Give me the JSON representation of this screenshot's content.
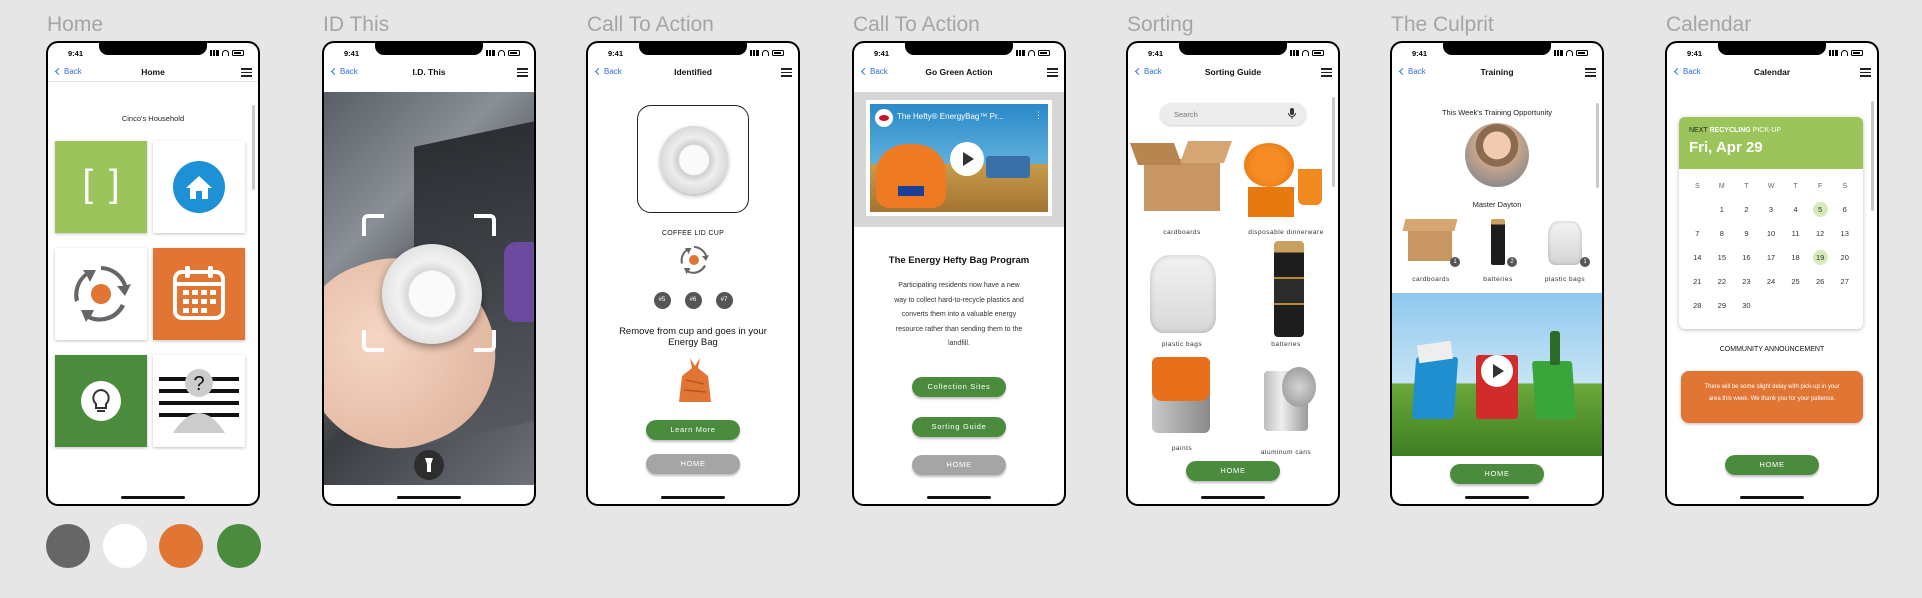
{
  "status_time": "9:41",
  "back_label": "Back",
  "colors": {
    "gray": "#666666",
    "white": "#ffffff",
    "orange": "#e07534",
    "green": "#4a8b3e",
    "lime": "#9bc45a"
  },
  "screens": [
    {
      "frame_title": "Home",
      "nav_title": "Home",
      "household": "Cinco's Household"
    },
    {
      "frame_title": "ID This",
      "nav_title": "I.D. This"
    },
    {
      "frame_title": "Call To Action",
      "nav_title": "Identified",
      "item_name": "COFFEE LID CUP",
      "codes": [
        "#5",
        "#6",
        "#7"
      ],
      "instruction": "Remove from cup and goes in your Energy Bag",
      "learn_more": "Learn More",
      "home": "HOME"
    },
    {
      "frame_title": "Call To Action",
      "nav_title": "Go Green Action",
      "video_title": "The Hefty® EnergyBag™ Pr...",
      "program_title": "The Energy Hefty Bag Program",
      "program_text": "Participating residents now have a new way to collect hard-to-recycle plastics and converts them into a valuable energy resource rather than sending them to the landfill.",
      "collection_sites": "Collection Sites",
      "sorting_guide": "Sorting Guide",
      "home": "HOME"
    },
    {
      "frame_title": "Sorting",
      "nav_title": "Sorting Guide",
      "search_placeholder": "Search",
      "items": [
        "cardboards",
        "disposable dinnerware",
        "plastic bags",
        "batteries",
        "paints",
        "aluminum cans"
      ],
      "home": "HOME"
    },
    {
      "frame_title": "The Culprit",
      "nav_title": "Training",
      "heading": "This Week's Training Opportunity",
      "trainee": "Master Dayton",
      "items": [
        {
          "label": "cardboards",
          "count": "1"
        },
        {
          "label": "batteries",
          "count": "2"
        },
        {
          "label": "plastic bags",
          "count": "1"
        }
      ],
      "home": "HOME"
    },
    {
      "frame_title": "Calendar",
      "nav_title": "Calendar",
      "next_prefix": "NEXT ",
      "next_recycling": "RECYCLING",
      "next_suffix": " PICK-UP",
      "next_date": "Fri, Apr 29",
      "weekdays": [
        "S",
        "M",
        "T",
        "W",
        "T",
        "F",
        "S"
      ],
      "days": [
        "",
        "1",
        "2",
        "3",
        "4",
        "5",
        "6",
        "7",
        "8",
        "9",
        "10",
        "11",
        "12",
        "13",
        "14",
        "15",
        "16",
        "17",
        "18",
        "19",
        "20",
        "21",
        "22",
        "23",
        "24",
        "25",
        "26",
        "27",
        "28",
        "29",
        "30",
        "",
        "",
        "",
        ""
      ],
      "highlighted_days": [
        "5",
        "19"
      ],
      "announcement_title": "COMMUNITY ANNOUNCEMENT",
      "announcement_text": "There will be some slight delay with pick-up in your area this week. We thank you for your patience.",
      "home": "HOME"
    }
  ]
}
